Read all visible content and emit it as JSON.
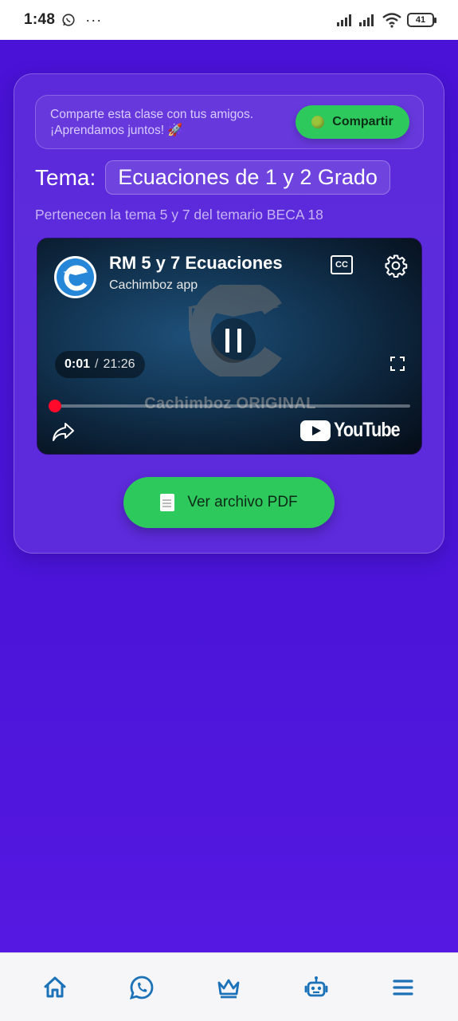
{
  "status_bar": {
    "time": "1:48",
    "dots": "···",
    "battery": "41"
  },
  "share": {
    "line1": "Comparte esta clase con tus amigos.",
    "line2": "¡Aprendamos juntos! 🚀",
    "button_label": "Compartir"
  },
  "topic": {
    "label": "Tema:",
    "name": "Ecuaciones de 1 y 2 Grado",
    "subtitle": "Pertenecen la tema 5 y 7 del temario BECA 18"
  },
  "video": {
    "title": "RM 5 y 7 Ecuaciones",
    "channel": "Cachimboz app",
    "cc_label": "CC",
    "current_time": "0:01",
    "separator": "/",
    "duration": "21:26",
    "watermark": "Cachimboz ORIGINAL",
    "youtube_label": "YouTube",
    "progress_fraction": 0.0008
  },
  "pdf_button": {
    "label": "Ver archivo PDF"
  },
  "bottom_nav": [
    "home-icon",
    "whatsapp-icon",
    "crown-icon",
    "robot-icon",
    "menu-icon"
  ],
  "colors": {
    "accent_green": "#2ec95c",
    "background_purple": "#4a12d6",
    "nav_icon": "#1c72b8"
  }
}
